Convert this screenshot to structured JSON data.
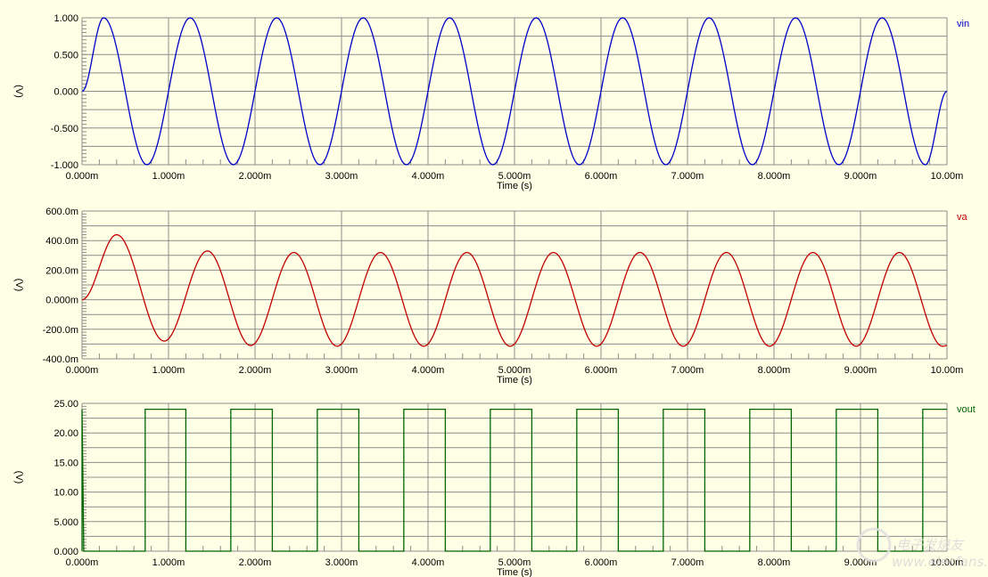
{
  "chart_data": [
    {
      "type": "line",
      "series_name": "vin",
      "color": "#0000C8",
      "xlabel": "Time (s)",
      "ylabel": "(V)",
      "xlim": [
        0,
        10
      ],
      "x_unit": "ms",
      "ylim": [
        -1,
        1
      ],
      "y_divisions": 8,
      "x_tick_labels": [
        "0.000m",
        "1.000m",
        "2.000m",
        "3.000m",
        "4.000m",
        "5.000m",
        "6.000m",
        "7.000m",
        "8.000m",
        "9.000m",
        "10.00m"
      ],
      "y_tick_labels": [
        "1.000",
        "0.500",
        "0.000",
        "-0.500",
        "-1.000"
      ],
      "grid": true,
      "extrema": [
        [
          0,
          0
        ],
        [
          0.25,
          1
        ],
        [
          0.75,
          -1
        ],
        [
          1.25,
          1
        ],
        [
          1.75,
          -1
        ],
        [
          2.25,
          1
        ],
        [
          2.75,
          -1
        ],
        [
          3.25,
          1
        ],
        [
          3.75,
          -1
        ],
        [
          4.25,
          1
        ],
        [
          4.75,
          -1
        ],
        [
          5.25,
          1
        ],
        [
          5.75,
          -1
        ],
        [
          6.25,
          1
        ],
        [
          6.75,
          -1
        ],
        [
          7.25,
          1
        ],
        [
          7.75,
          -1
        ],
        [
          8.25,
          1
        ],
        [
          8.75,
          -1
        ],
        [
          9.25,
          1
        ],
        [
          9.75,
          -1
        ],
        [
          10,
          0
        ]
      ]
    },
    {
      "type": "line",
      "series_name": "va",
      "color": "#C00000",
      "xlabel": "Time (s)",
      "ylabel": "(V)",
      "xlim": [
        0,
        10
      ],
      "x_unit": "ms",
      "ylim": [
        -0.4,
        0.6
      ],
      "y_divisions": 10,
      "x_tick_labels": [
        "0.000m",
        "1.000m",
        "2.000m",
        "3.000m",
        "4.000m",
        "5.000m",
        "6.000m",
        "7.000m",
        "8.000m",
        "9.000m",
        "10.00m"
      ],
      "y_tick_labels": [
        "600.0m",
        "400.0m",
        "200.0m",
        "0.000m",
        "-200.0m",
        "-400.0m"
      ],
      "grid": true,
      "extrema": [
        [
          0,
          0
        ],
        [
          0.4,
          0.44
        ],
        [
          0.95,
          -0.28
        ],
        [
          1.45,
          0.33
        ],
        [
          1.95,
          -0.31
        ],
        [
          2.45,
          0.32
        ],
        [
          2.95,
          -0.315
        ],
        [
          3.45,
          0.32
        ],
        [
          3.95,
          -0.315
        ],
        [
          4.45,
          0.32
        ],
        [
          4.95,
          -0.315
        ],
        [
          5.45,
          0.32
        ],
        [
          5.95,
          -0.315
        ],
        [
          6.45,
          0.32
        ],
        [
          6.95,
          -0.315
        ],
        [
          7.45,
          0.32
        ],
        [
          7.95,
          -0.315
        ],
        [
          8.45,
          0.32
        ],
        [
          8.95,
          -0.315
        ],
        [
          9.45,
          0.32
        ],
        [
          9.95,
          -0.315
        ],
        [
          10,
          -0.31
        ]
      ]
    },
    {
      "type": "line",
      "series_name": "vout",
      "color": "#006400",
      "xlabel": "Time (s)",
      "ylabel": "(V)",
      "xlim": [
        0,
        10
      ],
      "x_unit": "ms",
      "ylim": [
        0,
        25
      ],
      "y_divisions": 10,
      "x_tick_labels": [
        "0.000m",
        "1.000m",
        "2.000m",
        "3.000m",
        "4.000m",
        "5.000m",
        "6.000m",
        "7.000m",
        "8.000m",
        "9.000m",
        "10.00m"
      ],
      "y_tick_labels": [
        "25.00",
        "20.00",
        "15.00",
        "10.00",
        "5.000",
        "0.000"
      ],
      "grid": true,
      "high_level": 24,
      "low_level": 0,
      "high_intervals": [
        [
          0.73,
          1.2
        ],
        [
          1.72,
          2.2
        ],
        [
          2.72,
          3.2
        ],
        [
          3.72,
          4.2
        ],
        [
          4.72,
          5.2
        ],
        [
          5.72,
          6.2
        ],
        [
          6.72,
          7.2
        ],
        [
          7.72,
          8.2
        ],
        [
          8.72,
          9.2
        ],
        [
          9.72,
          10
        ]
      ],
      "initial_spike": [
        0,
        24
      ]
    }
  ],
  "watermark": {
    "line1": "电子发烧友",
    "line2": "www.elecfans.com"
  }
}
